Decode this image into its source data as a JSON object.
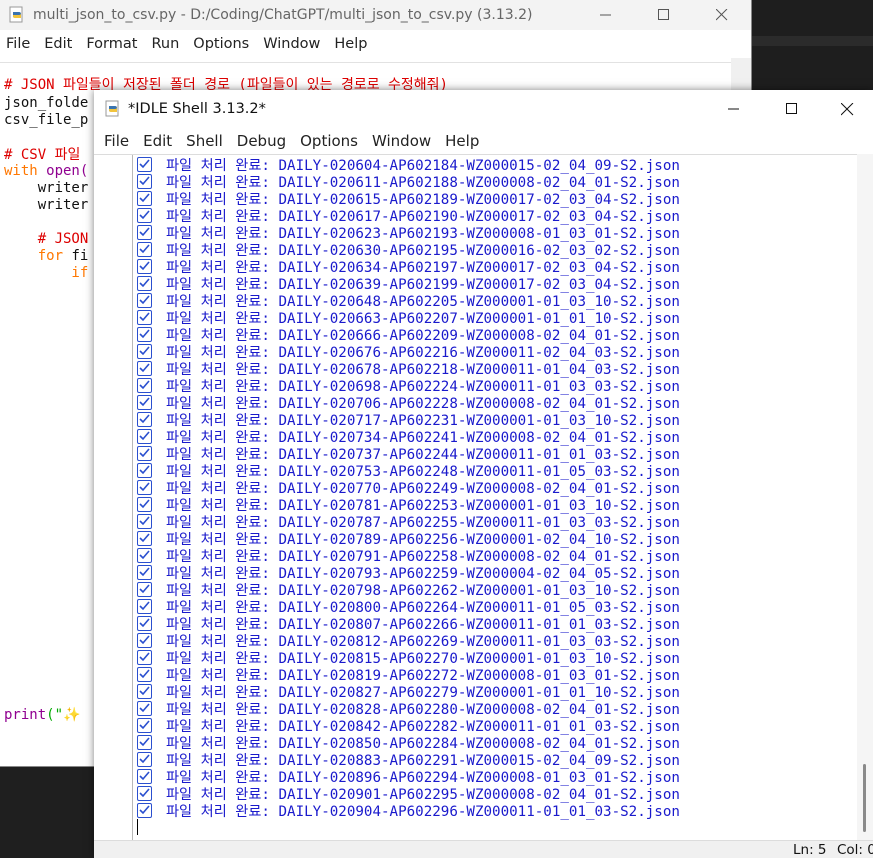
{
  "editor": {
    "title": "multi_json_to_csv.py - D:/Coding/ChatGPT/multi_json_to_csv.py (3.13.2)",
    "menu": [
      "File",
      "Edit",
      "Format",
      "Run",
      "Options",
      "Window",
      "Help"
    ],
    "code": {
      "l1": "# JSON 파일들이 저장된 폴더 경로 (파일들이 있는 경로로 수정해줘)",
      "l2": "json_folde",
      "l3": "csv_file_p",
      "l4": "# CSV 파일",
      "l5_kw": "with",
      "l5_rest": " open(",
      "l6": "    writer",
      "l7": "    writer",
      "l8": "    # JSON",
      "l9_kw": "    for",
      "l9_rest": " fi",
      "l10": "        if",
      "l11_fn": "print",
      "l11_rest": "(\"",
      "l11_str": "✨"
    }
  },
  "shell": {
    "title": "*IDLE Shell 3.13.2*",
    "menu": [
      "File",
      "Edit",
      "Shell",
      "Debug",
      "Options",
      "Window",
      "Help"
    ],
    "check_color": "#2a4fcf",
    "text_color": "#1a1acc",
    "lines": [
      "파일 처리 완료: DAILY-020604-AP602184-WZ000015-02_04_09-S2.json",
      "파일 처리 완료: DAILY-020611-AP602188-WZ000008-02_04_01-S2.json",
      "파일 처리 완료: DAILY-020615-AP602189-WZ000017-02_03_04-S2.json",
      "파일 처리 완료: DAILY-020617-AP602190-WZ000017-02_03_04-S2.json",
      "파일 처리 완료: DAILY-020623-AP602193-WZ000008-01_03_01-S2.json",
      "파일 처리 완료: DAILY-020630-AP602195-WZ000016-02_03_02-S2.json",
      "파일 처리 완료: DAILY-020634-AP602197-WZ000017-02_03_04-S2.json",
      "파일 처리 완료: DAILY-020639-AP602199-WZ000017-02_03_04-S2.json",
      "파일 처리 완료: DAILY-020648-AP602205-WZ000001-01_03_10-S2.json",
      "파일 처리 완료: DAILY-020663-AP602207-WZ000001-01_01_10-S2.json",
      "파일 처리 완료: DAILY-020666-AP602209-WZ000008-02_04_01-S2.json",
      "파일 처리 완료: DAILY-020676-AP602216-WZ000011-02_04_03-S2.json",
      "파일 처리 완료: DAILY-020678-AP602218-WZ000011-01_04_03-S2.json",
      "파일 처리 완료: DAILY-020698-AP602224-WZ000011-01_03_03-S2.json",
      "파일 처리 완료: DAILY-020706-AP602228-WZ000008-02_04_01-S2.json",
      "파일 처리 완료: DAILY-020717-AP602231-WZ000001-01_03_10-S2.json",
      "파일 처리 완료: DAILY-020734-AP602241-WZ000008-02_04_01-S2.json",
      "파일 처리 완료: DAILY-020737-AP602244-WZ000011-01_01_03-S2.json",
      "파일 처리 완료: DAILY-020753-AP602248-WZ000011-01_05_03-S2.json",
      "파일 처리 완료: DAILY-020770-AP602249-WZ000008-02_04_01-S2.json",
      "파일 처리 완료: DAILY-020781-AP602253-WZ000001-01_03_10-S2.json",
      "파일 처리 완료: DAILY-020787-AP602255-WZ000011-01_03_03-S2.json",
      "파일 처리 완료: DAILY-020789-AP602256-WZ000001-02_04_10-S2.json",
      "파일 처리 완료: DAILY-020791-AP602258-WZ000008-02_04_01-S2.json",
      "파일 처리 완료: DAILY-020793-AP602259-WZ000004-02_04_05-S2.json",
      "파일 처리 완료: DAILY-020798-AP602262-WZ000001-01_03_10-S2.json",
      "파일 처리 완료: DAILY-020800-AP602264-WZ000011-01_05_03-S2.json",
      "파일 처리 완료: DAILY-020807-AP602266-WZ000011-01_01_03-S2.json",
      "파일 처리 완료: DAILY-020812-AP602269-WZ000011-01_03_03-S2.json",
      "파일 처리 완료: DAILY-020815-AP602270-WZ000001-01_03_10-S2.json",
      "파일 처리 완료: DAILY-020819-AP602272-WZ000008-01_03_01-S2.json",
      "파일 처리 완료: DAILY-020827-AP602279-WZ000001-01_01_10-S2.json",
      "파일 처리 완료: DAILY-020828-AP602280-WZ000008-02_04_01-S2.json",
      "파일 처리 완료: DAILY-020842-AP602282-WZ000011-01_01_03-S2.json",
      "파일 처리 완료: DAILY-020850-AP602284-WZ000008-02_04_01-S2.json",
      "파일 처리 완료: DAILY-020883-AP602291-WZ000015-02_04_09-S2.json",
      "파일 처리 완료: DAILY-020896-AP602294-WZ000008-01_03_01-S2.json",
      "파일 처리 완료: DAILY-020901-AP602295-WZ000008-02_04_01-S2.json",
      "파일 처리 완료: DAILY-020904-AP602296-WZ000011-01_01_03-S2.json"
    ],
    "status": {
      "ln": "Ln: 5",
      "col": "Col: 0"
    }
  }
}
